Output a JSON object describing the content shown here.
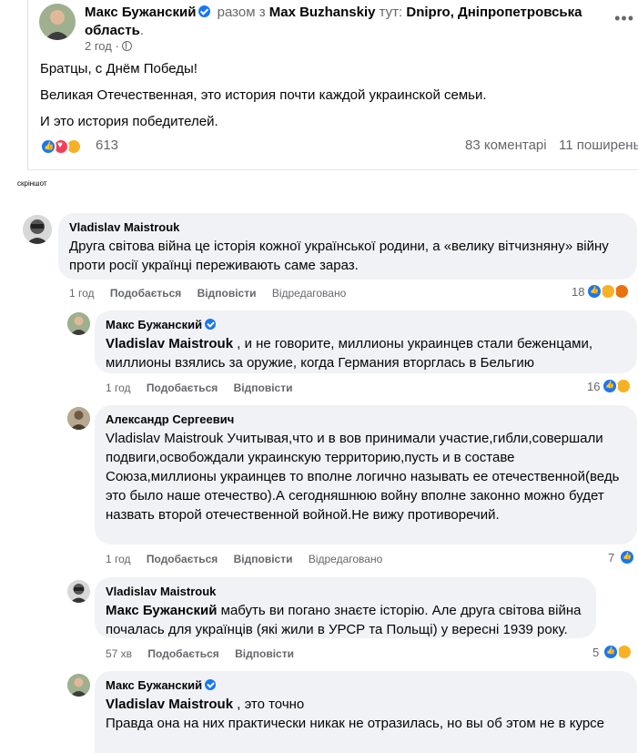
{
  "post": {
    "author": "Макс Бужанский",
    "with_text": "разом з",
    "coauthor": "Max Buzhanskiy",
    "location_prefix": "тут:",
    "location": "Dnipro, Дніпропетровська область",
    "location_suffix": ".",
    "time": "2 год ·",
    "body": [
      "Братцы, с Днём Победы!",
      "Великая Отечественная, это история почти каждой украинской семьи.",
      "И это история победителей."
    ],
    "reaction_count": "613",
    "comments_count": "83 коментарі",
    "shares_count": "11 поширень"
  },
  "screenshot_label": "скріншот",
  "action_labels": {
    "like": "Подобається",
    "reply": "Відповісти",
    "edited": "Відредаговано"
  },
  "comments": [
    {
      "author": "Vladislav Maistrouk",
      "text": "Друга світова війна це історія кожної української родини, а «велику вітчизняну» війну проти росії українці переживають саме зараз.",
      "time": "1 год",
      "edited": true,
      "reaction_count": "18"
    },
    {
      "author": "Макс Бужанский",
      "mention": "Vladislav Maistrouk",
      "text": ", и не говорите, миллионы украинцев стали беженцами, миллионы взялись за оружие, когда Германия вторглась в Бельгию",
      "time": "1 год",
      "edited": false,
      "reaction_count": "16"
    },
    {
      "author": "Александр Сергеевич",
      "text": "Vladislav Maistrouk Учитывая,что и в вов принимали участие,гибли,совершали подвиги,освобождали украинскую территорию,пусть и в составе Союза,миллионы украинцев то вполне логично называть ее отечественной(ведь это было наше отечество).А сегодняшнюю войну вполне законно можно будет назвать второй отечественной войной.Не вижу противоречий.",
      "time": "1 год",
      "edited": true,
      "reaction_count": "7"
    },
    {
      "author": "Vladislav Maistrouk",
      "mention": "Макс Бужанский",
      "text": "мабуть ви погано знаєте історію. Але друга світова війна почалась для українців (які жили в УРСР та Польщі) у вересні 1939 року.",
      "time": "57 хв",
      "edited": false,
      "reaction_count": "5"
    },
    {
      "author": "Макс Бужанский",
      "mention": "Vladislav Maistrouk",
      "text": ", это точно",
      "text2": "Правда она на них практически никак не отразилась, но вы об этом не в курсе"
    }
  ]
}
